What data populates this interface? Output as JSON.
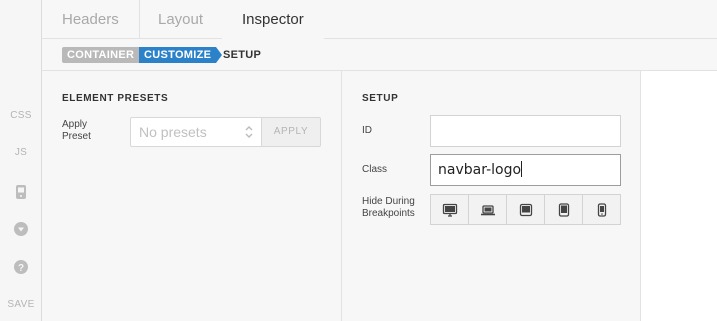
{
  "tabs": [
    {
      "label": "Headers",
      "active": false
    },
    {
      "label": "Layout",
      "active": false
    },
    {
      "label": "Inspector",
      "active": true
    }
  ],
  "breadcrumb": {
    "items": [
      "CONTAINER",
      "CUSTOMIZE",
      "SETUP"
    ],
    "active_color": "#2c82c9"
  },
  "rail": {
    "css_label": "CSS",
    "js_label": "JS",
    "icons": [
      "device-icon",
      "dropdown-circle-icon",
      "help-circle-icon"
    ],
    "save_label": "SAVE"
  },
  "presets": {
    "title": "ELEMENT PRESETS",
    "apply_label": "Apply Preset",
    "select_value": "No presets",
    "apply_button": "APPLY"
  },
  "setup": {
    "title": "SETUP",
    "id_label": "ID",
    "id_value": "",
    "class_label": "Class",
    "class_value": "navbar-logo",
    "hide_label": "Hide During Breakpoints",
    "breakpoints": [
      "desktop-icon",
      "laptop-icon",
      "tablet-landscape-icon",
      "tablet-portrait-icon",
      "phone-icon"
    ]
  }
}
